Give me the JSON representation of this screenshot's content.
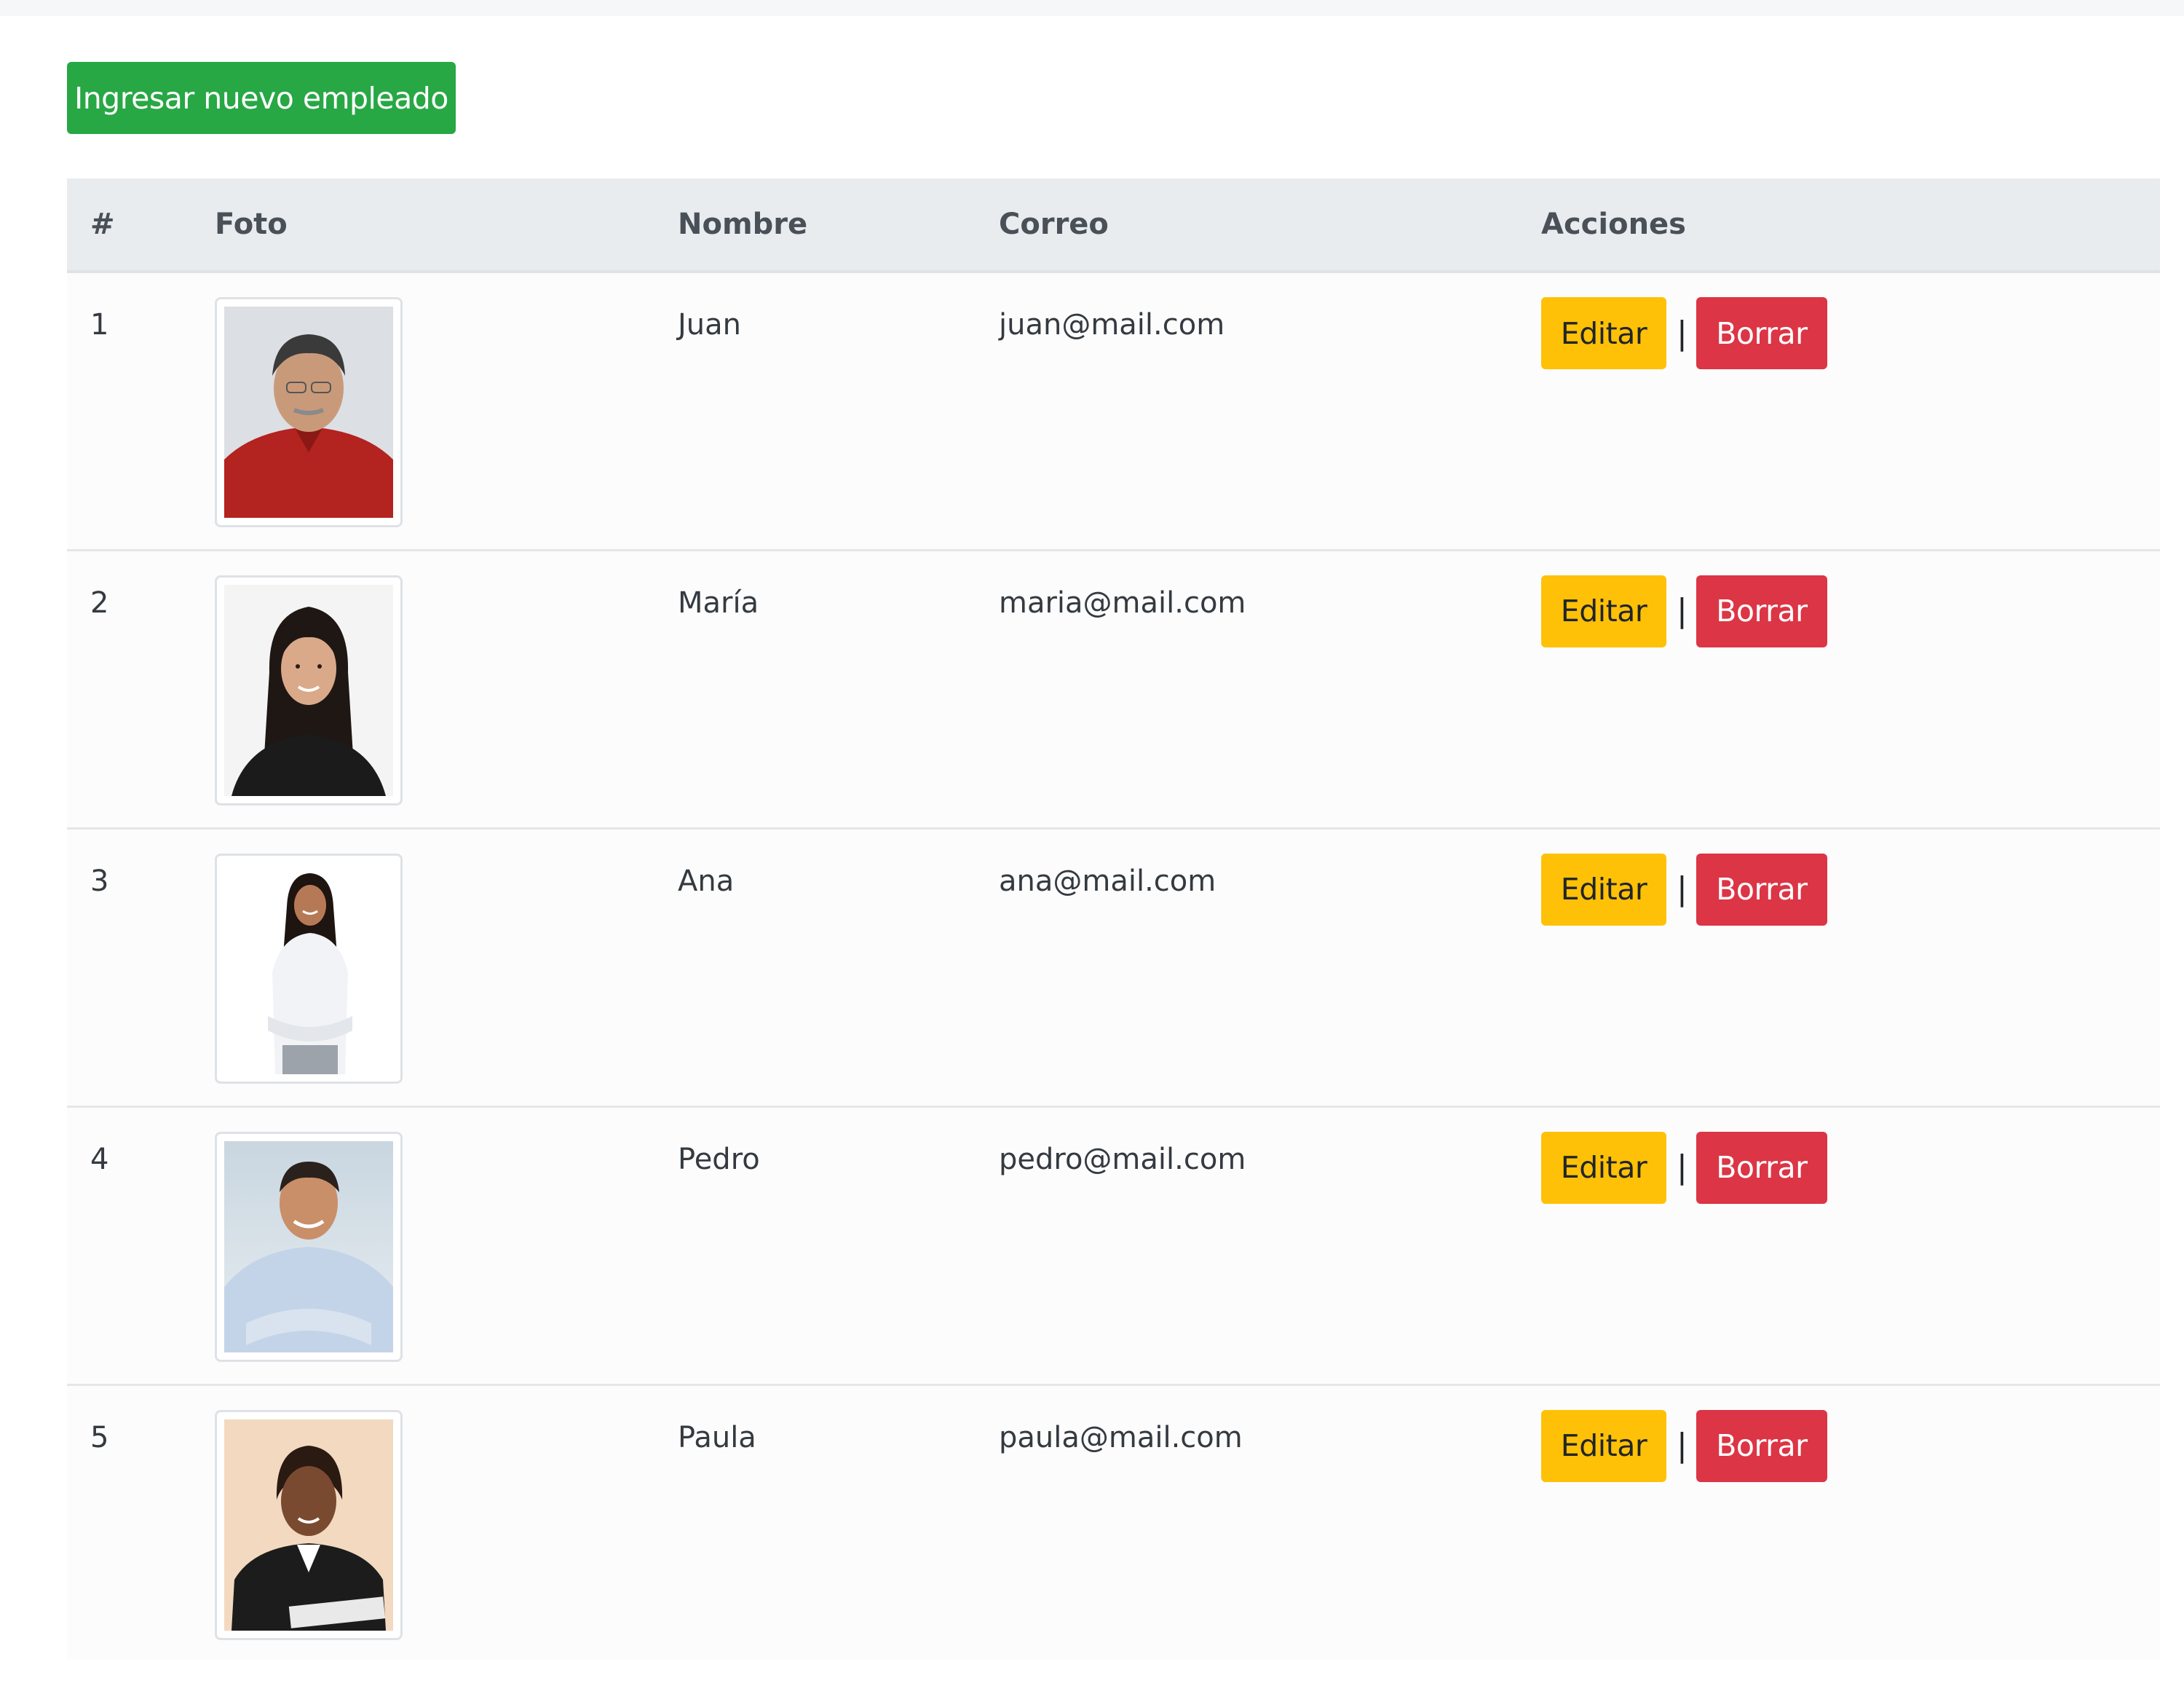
{
  "toolbar": {
    "new_employee_label": "Ingresar nuevo empleado"
  },
  "table": {
    "headers": [
      "#",
      "Foto",
      "Nombre",
      "Correo",
      "Acciones"
    ],
    "rows": [
      {
        "id": "1",
        "photo": "portrait of older man in red shirt",
        "name": "Juan",
        "email": "juan@mail.com",
        "edit_label": "Editar",
        "separator": "|",
        "delete_label": "Borrar"
      },
      {
        "id": "2",
        "photo": "portrait of woman with long dark hair in black top",
        "name": "María",
        "email": "maria@mail.com",
        "edit_label": "Editar",
        "separator": "|",
        "delete_label": "Borrar"
      },
      {
        "id": "3",
        "photo": "woman in white shirt with arms crossed",
        "name": "Ana",
        "email": "ana@mail.com",
        "edit_label": "Editar",
        "separator": "|",
        "delete_label": "Borrar"
      },
      {
        "id": "4",
        "photo": "smiling man in light blue shirt with arms crossed",
        "name": "Pedro",
        "email": "pedro@mail.com",
        "edit_label": "Editar",
        "separator": "|",
        "delete_label": "Borrar"
      },
      {
        "id": "5",
        "photo": "woman in black blazer writing at desk",
        "name": "Paula",
        "email": "paula@mail.com",
        "edit_label": "Editar",
        "separator": "|",
        "delete_label": "Borrar"
      }
    ]
  },
  "colors": {
    "success": "#28a745",
    "warning": "#ffc107",
    "danger": "#dc3545",
    "header_bg": "#e9ecef"
  }
}
